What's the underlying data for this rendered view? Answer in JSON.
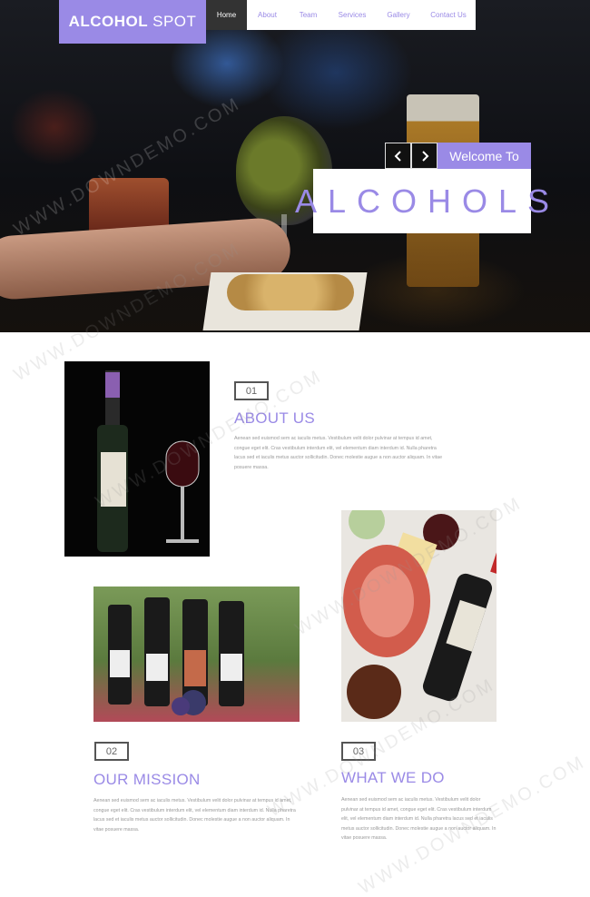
{
  "brand": {
    "bold": "ALCOHOL",
    "light": "SPOT",
    "color": "#9a8ae6"
  },
  "nav": {
    "items": [
      "Home",
      "About",
      "Team",
      "Services",
      "Gallery",
      "Contact Us"
    ],
    "active": "Home"
  },
  "hero": {
    "welcome": "Welcome To",
    "headline": "ALCOHOLS",
    "prev_icon": "chevron-left-icon",
    "next_icon": "chevron-right-icon"
  },
  "watermark": "WWW.DOWNDEMO.COM",
  "sections": {
    "about": {
      "number": "01",
      "title": "ABOUT US",
      "text": "Aenean sed euismod sem ac iaculis metus. Vestibulum velit dolor pulvinar at tempus id amet, congue eget elit. Cras vestibulum interdum elit, vel elementum diam interdum id. Nulla pharetra lacus sed et iaculis metus auctor sollicitudin. Donec molestie augue a non auctor aliquam. In vitae posuere massa."
    },
    "mission": {
      "number": "02",
      "title": "OUR MISSION",
      "text": "Aenean sed euismod sem ac iaculis metus. Vestibulum velit dolor pulvinar at tempus id amet, congue eget elit. Cras vestibulum interdum elit, vel elementum diam interdum id. Nulla pharetra lacus sed et iaculis metus auctor sollicitudin. Donec molestie augue a non auctor aliquam. In vitae posuere massa."
    },
    "what_we_do": {
      "number": "03",
      "title": "WHAT WE DO",
      "text": "Aenean sed euismod sem ac iaculis metus. Vestibulum velit dolor pulvinar at tempus id amet, congue eget elit. Cras vestibulum interdum elit, vel elementum diam interdum id. Nulla pharetra lacus sed et iaculis metus auctor sollicitudin. Donec molestie augue a non auctor aliquam. In vitae posuere massa."
    }
  }
}
